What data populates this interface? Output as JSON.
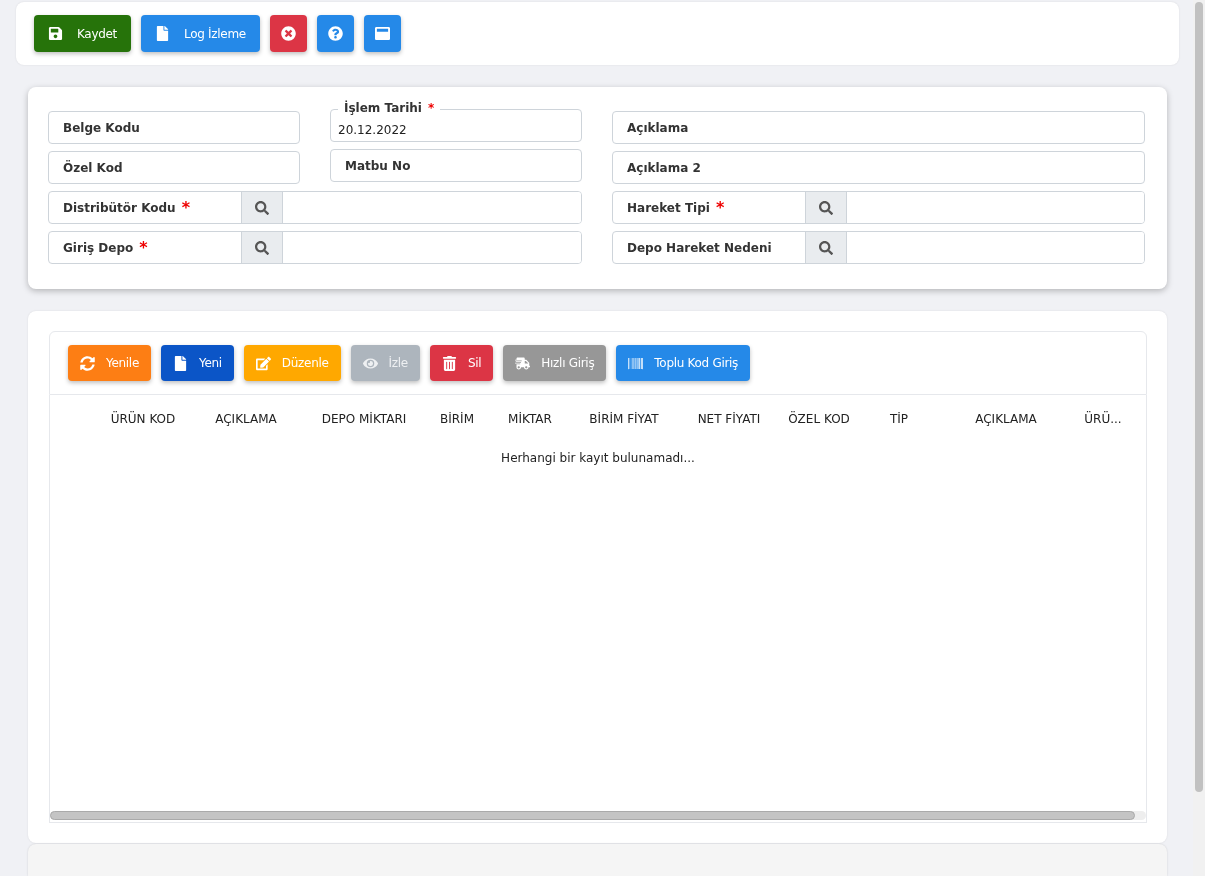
{
  "toolbar": [
    {
      "label": "Kaydet",
      "color": "#26730a"
    },
    {
      "label": "Log İzleme",
      "color": "#2589e8"
    },
    {
      "color": "#dc3545"
    },
    {
      "color": "#2589e8"
    },
    {
      "color": "#2589e8"
    }
  ],
  "form": {
    "columns": [
      [
        {
          "kind": "text",
          "label": "Belge Kodu"
        },
        {
          "kind": "text",
          "label": "Özel Kod"
        }
      ],
      [
        {
          "kind": "date",
          "label": "İşlem Tarihi",
          "required_mark": "*",
          "value": "20.12.2022"
        },
        {
          "kind": "text",
          "label": "Matbu No"
        }
      ],
      [
        {
          "kind": "text",
          "label": "Açıklama"
        },
        {
          "kind": "text",
          "label": "Açıklama 2"
        }
      ]
    ],
    "lookups_left": [
      {
        "label": "Distribütör Kodu",
        "required_mark": "*"
      },
      {
        "label": "Giriş Depo",
        "required_mark": "*"
      }
    ],
    "lookups_right": [
      {
        "label": "Hareket Tipi",
        "required_mark": "*"
      },
      {
        "label": "Depo Hareket Nedeni"
      }
    ]
  },
  "grid_toolbar": [
    {
      "label": "Yenile",
      "color": "#fd7e14",
      "disabled": false
    },
    {
      "label": "Yeni",
      "color": "#0b55c7",
      "disabled": false
    },
    {
      "label": "Düzenle",
      "color": "#ffa800",
      "disabled": false
    },
    {
      "label": "İzle",
      "color": "#adb5bd",
      "disabled": true
    },
    {
      "label": "Sil",
      "color": "#dc3545",
      "disabled": false
    },
    {
      "label": "Hızlı Giriş",
      "color": "#979797",
      "disabled": false
    },
    {
      "label": "Toplu Kod Giriş",
      "color": "#2589e8",
      "disabled": false
    }
  ],
  "table": {
    "columns": [
      "ÜRÜN KOD",
      "AÇIKLAMA",
      "DEPO MİKTARI",
      "BİRİM",
      "MİKTAR",
      "BİRİM FİYAT",
      "NET FİYATI",
      "ÖZEL KOD",
      "TİP",
      "AÇIKLAMA",
      "ÜRÜ..."
    ],
    "empty_message": "Herhangi bir kayıt bulunamadı..."
  }
}
